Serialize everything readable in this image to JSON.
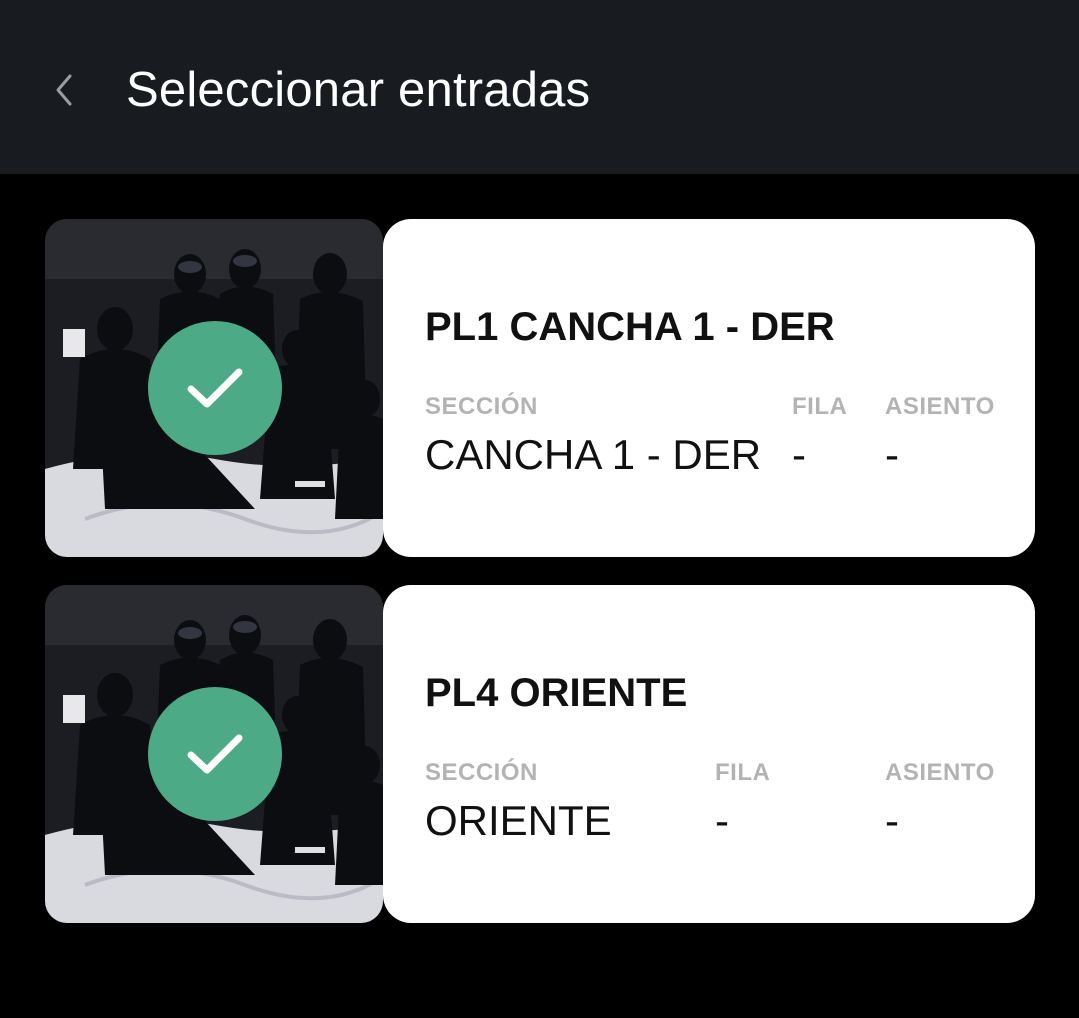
{
  "header": {
    "title": "Seleccionar entradas",
    "back_icon": "chevron-left-icon"
  },
  "colors": {
    "topbar": "#181b1f",
    "background": "#000000",
    "card": "#ffffff",
    "check": "#4daa86",
    "label": "#b3b3b3"
  },
  "tickets": [
    {
      "name": "PL1 CANCHA 1 - DER",
      "selected": true,
      "section_label": "SECCIÓN",
      "section_value": "CANCHA 1 - DER",
      "row_label": "FILA",
      "row_value": "-",
      "seat_label": "ASIENTO",
      "seat_value": "-"
    },
    {
      "name": "PL4 ORIENTE",
      "selected": true,
      "section_label": "SECCIÓN",
      "section_value": "ORIENTE",
      "row_label": "FILA",
      "row_value": "-",
      "seat_label": "ASIENTO",
      "seat_value": "-"
    }
  ]
}
